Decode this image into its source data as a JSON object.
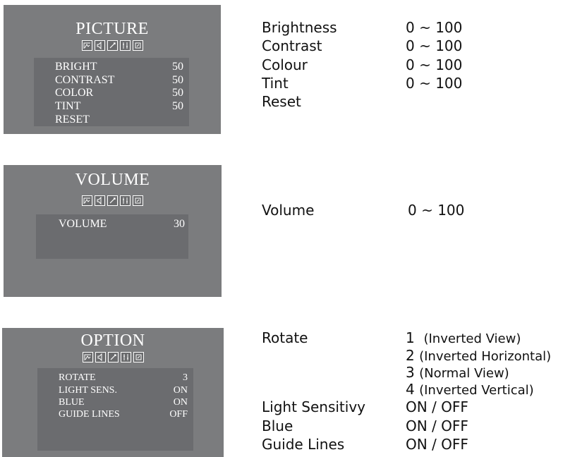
{
  "picture": {
    "title": "PICTURE",
    "icons": [
      "picture-menu-icon",
      "volume-menu-icon",
      "setup-menu-icon",
      "option-menu-icon",
      "exit-menu-icon"
    ],
    "items": [
      {
        "label": "BRIGHT",
        "value": "50"
      },
      {
        "label": "CONTRAST",
        "value": "50"
      },
      {
        "label": "COLOR",
        "value": "50"
      },
      {
        "label": "TINT",
        "value": "50"
      },
      {
        "label": "RESET",
        "value": ""
      }
    ],
    "desc": [
      {
        "name": "Brightness",
        "range": "0 ~ 100"
      },
      {
        "name": "Contrast",
        "range": "0 ~ 100"
      },
      {
        "name": "Colour",
        "range": "0 ~ 100"
      },
      {
        "name": "Tint",
        "range": "0 ~ 100"
      },
      {
        "name": "Reset",
        "range": ""
      }
    ]
  },
  "volume": {
    "title": "VOLUME",
    "items": [
      {
        "label": "VOLUME",
        "value": "30"
      }
    ],
    "desc": [
      {
        "name": "Volume",
        "range": "0 ~ 100"
      }
    ]
  },
  "option": {
    "title": "OPTION",
    "items": [
      {
        "label": "ROTATE",
        "value": "3"
      },
      {
        "label": "LIGHT SENS.",
        "value": "ON"
      },
      {
        "label": "BLUE",
        "value": "ON"
      },
      {
        "label": "GUIDE LINES",
        "value": "OFF"
      }
    ],
    "rotate": {
      "name": "Rotate",
      "options": [
        {
          "num": "1",
          "text": "(Inverted View)"
        },
        {
          "num": "2",
          "text": "(Inverted Horizontal)"
        },
        {
          "num": "3",
          "text": "(Normal View)"
        },
        {
          "num": "4",
          "text": "(Inverted Vertical)"
        }
      ]
    },
    "desc": [
      {
        "name": "Light Sensitivy",
        "range": "ON / OFF"
      },
      {
        "name": "Blue",
        "range": "ON / OFF"
      },
      {
        "name": "Guide Lines",
        "range": "ON / OFF"
      }
    ]
  }
}
